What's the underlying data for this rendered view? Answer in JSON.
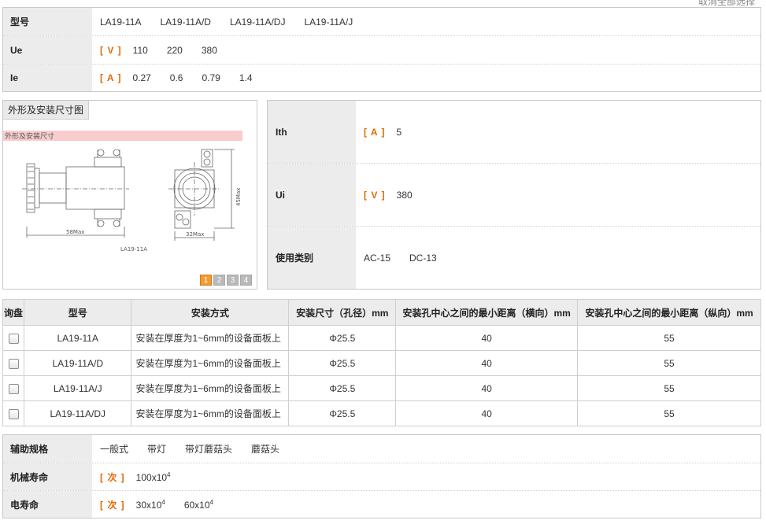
{
  "top_note": "取消全部选择",
  "spec_top": {
    "rows": [
      {
        "key": "型号",
        "unit": "",
        "values": [
          "LA19-11A",
          "LA19-11A/D",
          "LA19-11A/DJ",
          "LA19-11A/J"
        ]
      },
      {
        "key": "Ue",
        "unit": "[ V ]",
        "values": [
          "110",
          "220",
          "380"
        ]
      },
      {
        "key": "Ie",
        "unit": "[ A ]",
        "values": [
          "0.27",
          "0.6",
          "0.79",
          "1.4"
        ]
      }
    ]
  },
  "drawing": {
    "tab_label": "外形及安装尺寸图",
    "caption": "外形及安装尺寸",
    "dim_length": "58Max",
    "dim_width": "32Max",
    "dim_height": "45Max",
    "model_label": "LA19-11A",
    "pages": [
      "1",
      "2",
      "3",
      "4"
    ],
    "active_page": "1"
  },
  "spec_right": {
    "rows": [
      {
        "key": "Ith",
        "unit": "[ A ]",
        "values": [
          "5"
        ]
      },
      {
        "key": "Ui",
        "unit": "[ V ]",
        "values": [
          "380"
        ]
      },
      {
        "key": "使用类别",
        "unit": "",
        "values": [
          "AC-15",
          "DC-13"
        ]
      }
    ]
  },
  "table": {
    "headers": [
      "询盘",
      "型号",
      "安装方式",
      "安装尺寸（孔径）mm",
      "安装孔中心之间的最小距离（横向）mm",
      "安装孔中心之间的最小距离（纵向）mm"
    ],
    "rows": [
      {
        "model": "LA19-11A",
        "mount": "安装在厚度为1~6mm的设备面板上",
        "size": "Φ25.5",
        "h": "40",
        "v": "55"
      },
      {
        "model": "LA19-11A/D",
        "mount": "安装在厚度为1~6mm的设备面板上",
        "size": "Φ25.5",
        "h": "40",
        "v": "55"
      },
      {
        "model": "LA19-11A/J",
        "mount": "安装在厚度为1~6mm的设备面板上",
        "size": "Φ25.5",
        "h": "40",
        "v": "55"
      },
      {
        "model": "LA19-11A/DJ",
        "mount": "安装在厚度为1~6mm的设备面板上",
        "size": "Φ25.5",
        "h": "40",
        "v": "55"
      }
    ]
  },
  "spec_bottom": {
    "rows": [
      {
        "key": "辅助规格",
        "unit": "",
        "values": [
          "一般式",
          "带灯",
          "带灯蘑菇头",
          "蘑菇头"
        ]
      },
      {
        "key": "机械寿命",
        "unit": "[ 次 ]",
        "values": [
          {
            "base": "100x10",
            "exp": "4"
          }
        ]
      },
      {
        "key": "电寿命",
        "unit": "[ 次 ]",
        "values": [
          {
            "base": "30x10",
            "exp": "4"
          },
          {
            "base": "60x10",
            "exp": "4"
          }
        ]
      }
    ]
  },
  "colors": {
    "accent": "#e06a00",
    "header_bg": "#ececec",
    "pager_active": "#f39a34",
    "caption_bar": "#f9cdcd"
  }
}
